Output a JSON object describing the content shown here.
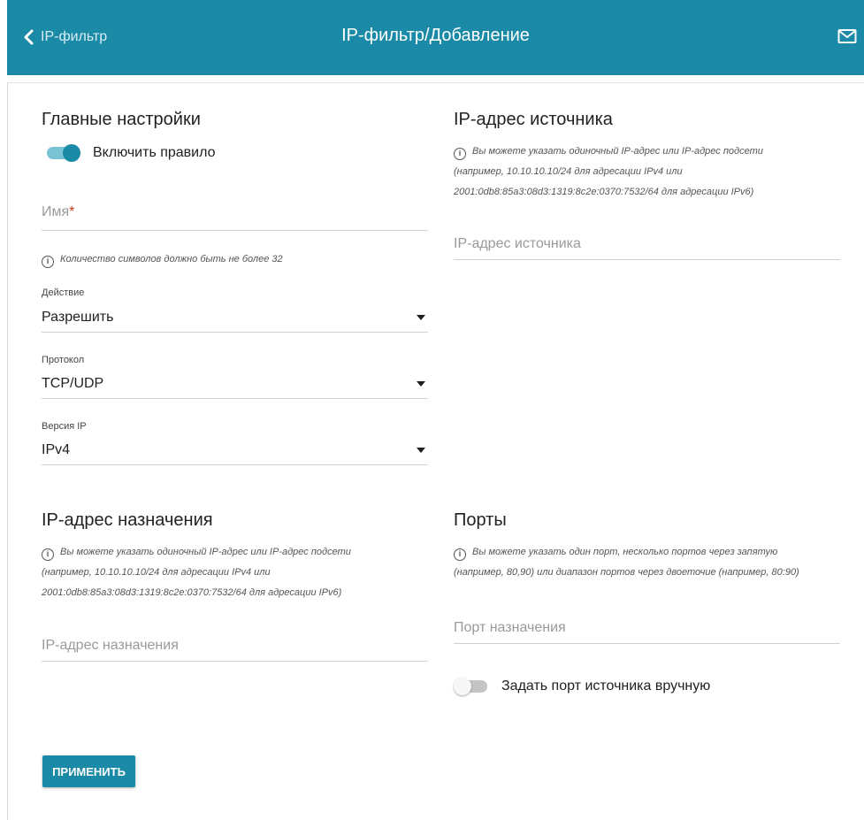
{
  "header": {
    "back_label": "IP-фильтр",
    "title": "IP-фильтр/Добавление",
    "mail_icon": "mail-icon",
    "color": "#1b8aa7"
  },
  "main_settings": {
    "heading": "Главные настройки",
    "enable_rule_label": "Включить правило",
    "enable_rule_on": true,
    "name_placeholder": "Имя",
    "name_required_mark": "*",
    "name_value": "",
    "name_hint": "Количество символов должно быть не более 32",
    "action_label": "Действие",
    "action_value": "Разрешить",
    "protocol_label": "Протокол",
    "protocol_value": "TCP/UDP",
    "ip_version_label": "Версия IP",
    "ip_version_value": "IPv4"
  },
  "source": {
    "heading": "IP-адрес источника",
    "hint_line1": "Вы можете указать одиночный IP-адрес или IP-адрес подсети",
    "hint_line2": "(например, 10.10.10.10/24 для адресации IPv4 или",
    "hint_line3": "2001:0db8:85a3:08d3:1319:8c2e:0370:7532/64 для адресации IPv6)",
    "placeholder": "IP-адрес источника",
    "value": ""
  },
  "destination": {
    "heading": "IP-адрес назначения",
    "hint_line1": "Вы можете указать одиночный IP-адрес или IP-адрес подсети",
    "hint_line2": "(например, 10.10.10.10/24 для адресации IPv4 или",
    "hint_line3": "2001:0db8:85a3:08d3:1319:8c2e:0370:7532/64 для адресации IPv6)",
    "placeholder": "IP-адрес назначения",
    "value": ""
  },
  "ports": {
    "heading": "Порты",
    "hint_line1": "Вы можете указать один порт, несколько портов через запятую",
    "hint_line2": "(например, 80,90) или диапазон портов через двоеточие (например, 80:90)",
    "dest_port_placeholder": "Порт назначения",
    "dest_port_value": "",
    "manual_source_label": "Задать порт источника вручную",
    "manual_source_on": false
  },
  "actions": {
    "apply_label": "ПРИМЕНИТЬ"
  }
}
